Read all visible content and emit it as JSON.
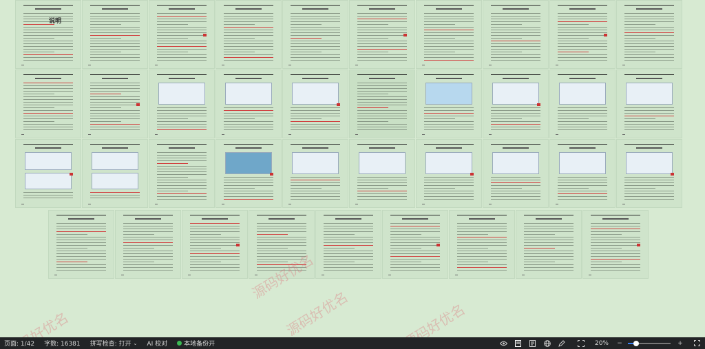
{
  "cover": {
    "title": "说明"
  },
  "watermark": {
    "text": "源码好优名"
  },
  "statusbar": {
    "page": "页面: 1/42",
    "wordcount": "字数: 16381",
    "spellcheck": "拼写检查: 打开",
    "ai": "AI 校对",
    "backup": "本地备份开",
    "zoom": "20%"
  },
  "zoom_slider": {
    "level": 0.2
  },
  "colors": {
    "canvas": "#d7ead2",
    "statusbar_bg": "#222426",
    "backup_dot": "#3cba54"
  },
  "icons": [
    "eye-icon",
    "page-view-icon",
    "outline-view-icon",
    "web-view-icon",
    "pen-icon",
    "fit-page-icon",
    "zoom-out-icon",
    "zoom-in-icon",
    "fullscreen-icon"
  ]
}
